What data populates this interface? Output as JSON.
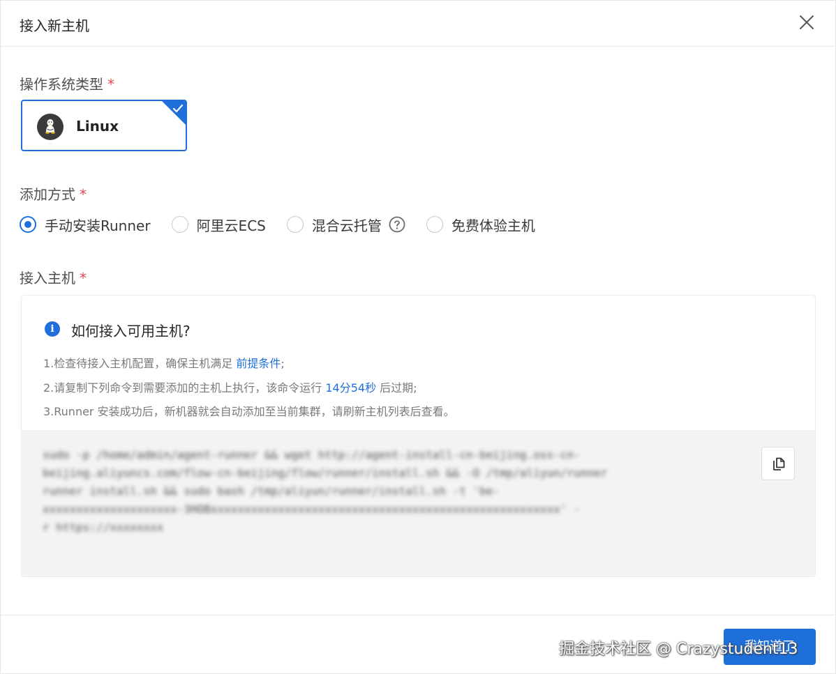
{
  "dialog": {
    "title": "接入新主机"
  },
  "os": {
    "label": "操作系统类型",
    "required_mark": "*",
    "selected": "Linux",
    "icon": "linux-tux-icon"
  },
  "method": {
    "label": "添加方式",
    "required_mark": "*",
    "options": [
      {
        "label": "手动安装Runner",
        "selected": true
      },
      {
        "label": "阿里云ECS",
        "selected": false
      },
      {
        "label": "混合云托管",
        "selected": false,
        "help": true
      },
      {
        "label": "免费体验主机",
        "selected": false
      }
    ]
  },
  "host": {
    "label": "接入主机",
    "required_mark": "*",
    "info_title": "如何接入可用主机?",
    "step1_text": "1.检查待接入主机配置，确保主机满足 ",
    "step1_link": "前提条件",
    "step1_end": ";",
    "step2_text": "2.请复制下列命令到需要添加的主机上执行，该命令运行 ",
    "step2_time": "14分54秒",
    "step2_end": " 后过期;",
    "step3_text": "3.Runner 安装成功后，新机器就会自动添加至当前集群，请刷新主机列表后查看。",
    "command_lines": [
      "sudo -p /home/admin/agent-runner && wget http://agent-install-cn-beijing.oss-cn-",
      "beijing.aliyuncs.com/flow-cn-beijing/flow/runner/install.sh && -O /tmp/aliyun/runner",
      "runner install.sh && sudo bash /tmp/aliyun/runner/install.sh -t 'be-",
      "xxxxxxxxxxxxxxxxxxxx-3HOBxxxxxxxxxxxxxxxxxxxxxxxxxxxxxxxxxxxxxxxxxxxxxxxxxxxx' -",
      "r https://xxxxxxxx"
    ]
  },
  "footer": {
    "ok_label": "我知道了",
    "watermark": "掘金技术社区 @ Crazystudent13"
  },
  "colors": {
    "accent": "#1e6fd9",
    "required": "#e5484d"
  }
}
